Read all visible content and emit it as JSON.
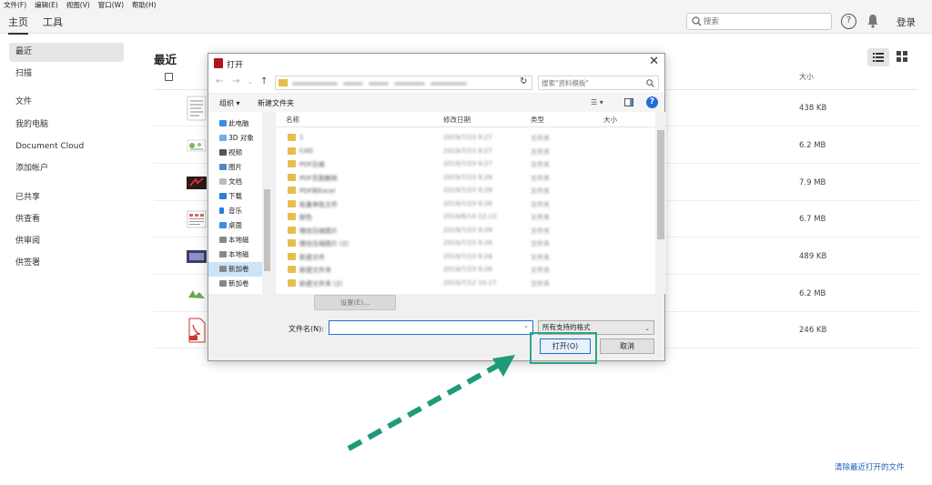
{
  "menu": [
    "文件(F)",
    "编辑(E)",
    "视图(V)",
    "窗口(W)",
    "帮助(H)"
  ],
  "nav": {
    "tabs": [
      "主页",
      "工具"
    ],
    "search_placeholder": "搜索",
    "login_label": "登录"
  },
  "sidebar": {
    "items": [
      "最近",
      "扫描",
      "文件",
      "我的电脑",
      "Document Cloud",
      "添加帐户",
      "已共享",
      "供查看",
      "供审阅",
      "供签署"
    ]
  },
  "main": {
    "title": "最近",
    "size_header": "大小",
    "rows": [
      {
        "size": "438 KB"
      },
      {
        "size": "6.2 MB"
      },
      {
        "size": "7.9 MB"
      },
      {
        "size": "6.7 MB"
      },
      {
        "size": "489 KB"
      },
      {
        "size": "6.2 MB"
      },
      {
        "size": "246 KB"
      }
    ],
    "clear_recent_label": "清除最近打开的文件"
  },
  "dialog": {
    "title": "打开",
    "search_placeholder": "搜索\"资料模板\"",
    "organize_label": "组织 ▾",
    "new_folder_label": "新建文件夹",
    "tree": [
      "此电脑",
      "3D 对象",
      "视频",
      "图片",
      "文档",
      "下载",
      "音乐",
      "桌面",
      "本地磁",
      "本地磁",
      "新加卷",
      "新加卷"
    ],
    "columns": [
      "名称",
      "修改日期",
      "类型",
      "大小"
    ],
    "files": [
      {
        "name": "1",
        "date": "2019/7/23 9:27",
        "type": "文件夹"
      },
      {
        "name": "CAD",
        "date": "2019/7/23 9:27",
        "type": "文件夹"
      },
      {
        "name": "PDF压缩",
        "date": "2019/7/23 9:27",
        "type": "文件夹"
      },
      {
        "name": "PDF页面删除",
        "date": "2019/7/23 9:28",
        "type": "文件夹"
      },
      {
        "name": "PDF转Excel",
        "date": "2019/7/23 9:28",
        "type": "文件夹"
      },
      {
        "name": "批量审批文件",
        "date": "2019/7/23 9:28",
        "type": "文件夹"
      },
      {
        "name": "颜色",
        "date": "2019/8/14 12:13",
        "type": "文件夹"
      },
      {
        "name": "微信压缩图片",
        "date": "2019/7/23 9:28",
        "type": "文件夹"
      },
      {
        "name": "微信压缩图片 (2)",
        "date": "2019/7/23 9:28",
        "type": "文件夹"
      },
      {
        "name": "新建文件",
        "date": "2019/7/23 9:28",
        "type": "文件夹"
      },
      {
        "name": "新建文件夹",
        "date": "2019/7/23 9:28",
        "type": "文件夹"
      },
      {
        "name": "新建文件夹 (2)",
        "date": "2019/7/12 15:17",
        "type": "文件夹"
      }
    ],
    "settings_label": "设置(E)...",
    "filename_label": "文件名(N):",
    "filename_value": "",
    "filetype_value": "所有支持的格式",
    "open_label": "打开(O)",
    "cancel_label": "取消"
  },
  "colors": {
    "accent": "#1f6fd1",
    "highlight": "#2aa58a",
    "arrow": "#1f9a7a"
  }
}
